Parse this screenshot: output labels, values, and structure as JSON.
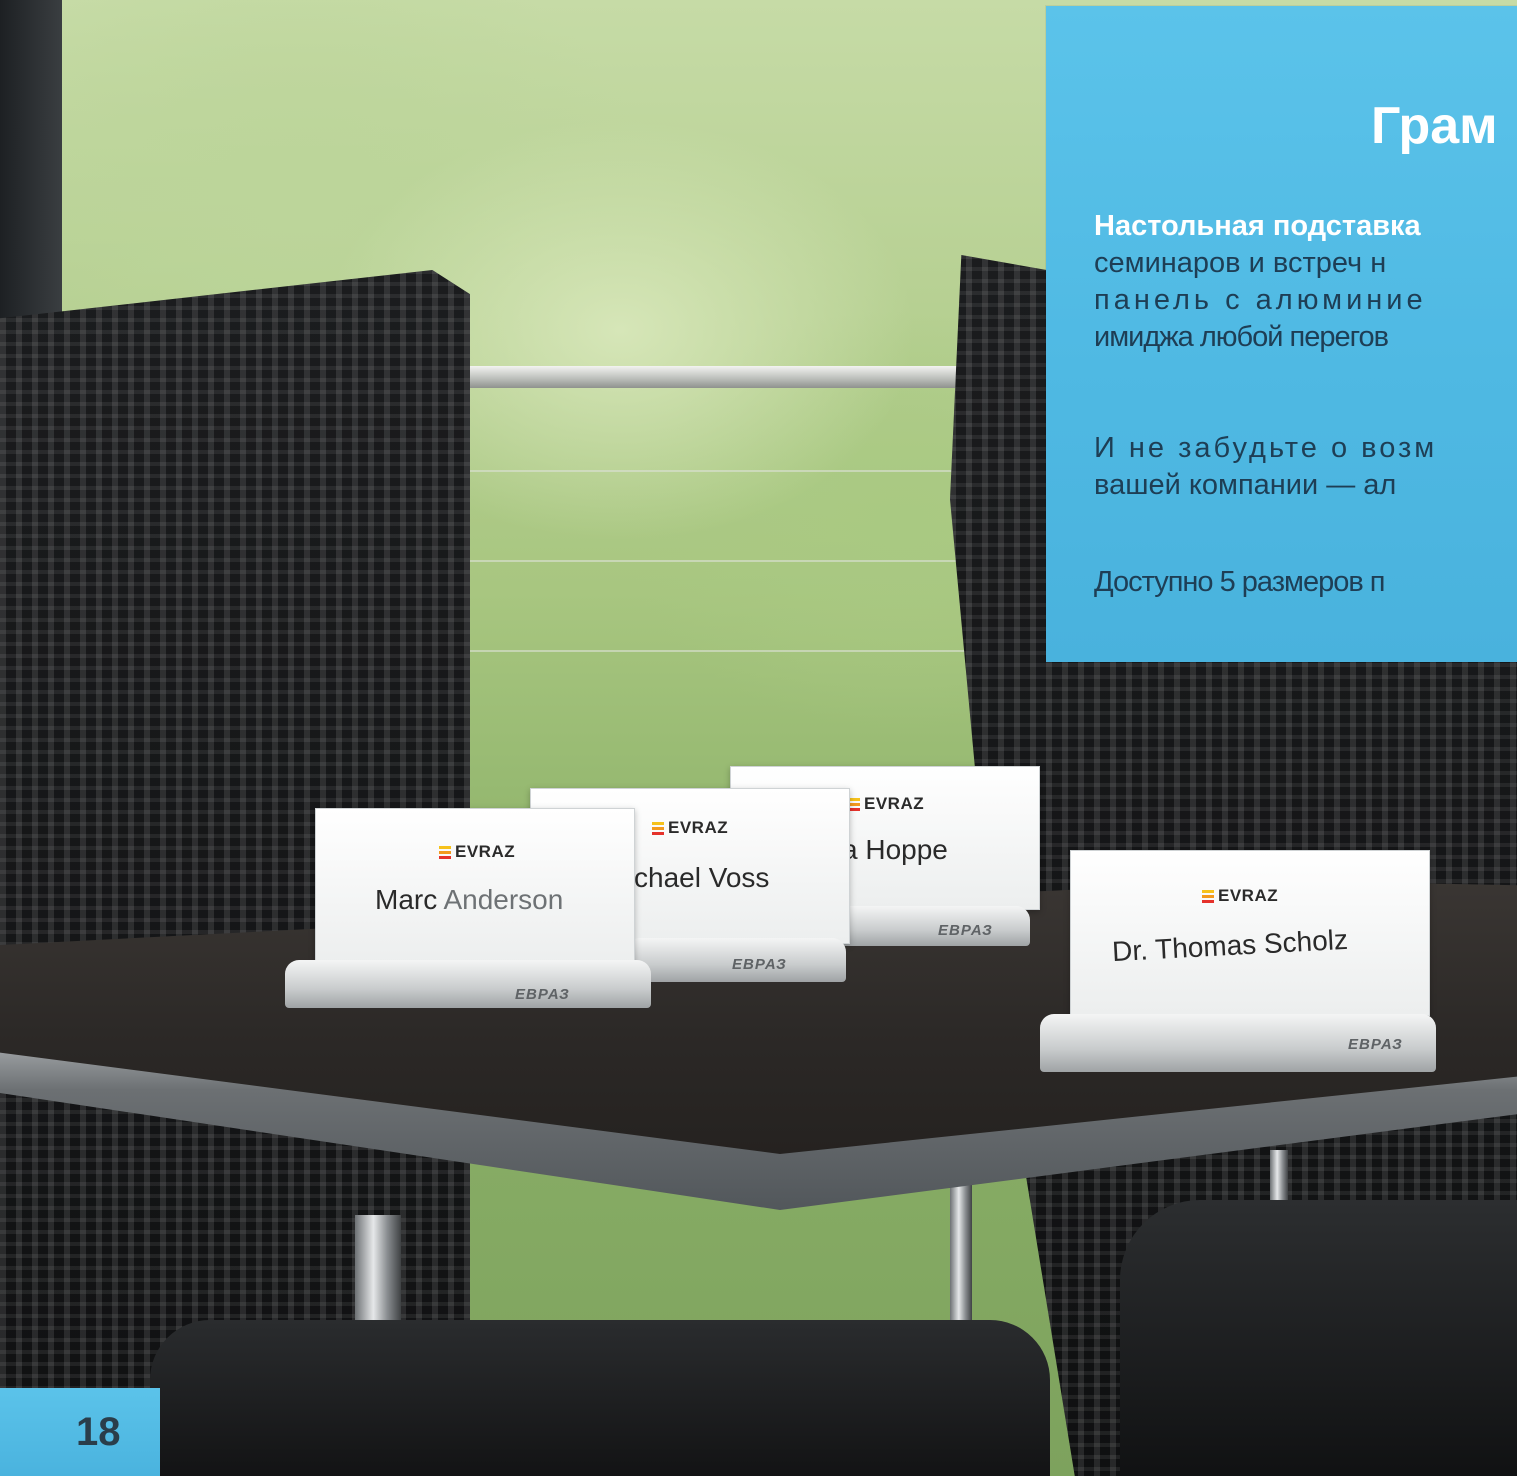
{
  "panel": {
    "title": "Грам",
    "lines": [
      "Настольная подставка",
      "семинаров и встреч н",
      "панель с алюминие",
      "имиджа любой перегов",
      "И не забудьте о возм",
      "вашей компании — ал",
      "Доступно 5 размеров п"
    ]
  },
  "page_number": "18",
  "holders": [
    {
      "logo": "EVRAZ",
      "name_dark": "Marc",
      "name_light": "Anderson",
      "base": "ЕВРАЗ"
    },
    {
      "logo": "EVRAZ",
      "name": "chael Voss",
      "base": "ЕВРАЗ"
    },
    {
      "logo": "EVRAZ",
      "name": "sa Hoppe",
      "base": "ЕВРАЗ"
    },
    {
      "logo": "EVRAZ",
      "name": "Dr. Thomas Scholz",
      "base": "ЕВРАЗ"
    }
  ],
  "colors": {
    "panel_blue": "#4fb9e3",
    "logo_orange": "#f39a1e",
    "logo_red": "#e5322b",
    "logo_yellow": "#f6c21c"
  }
}
